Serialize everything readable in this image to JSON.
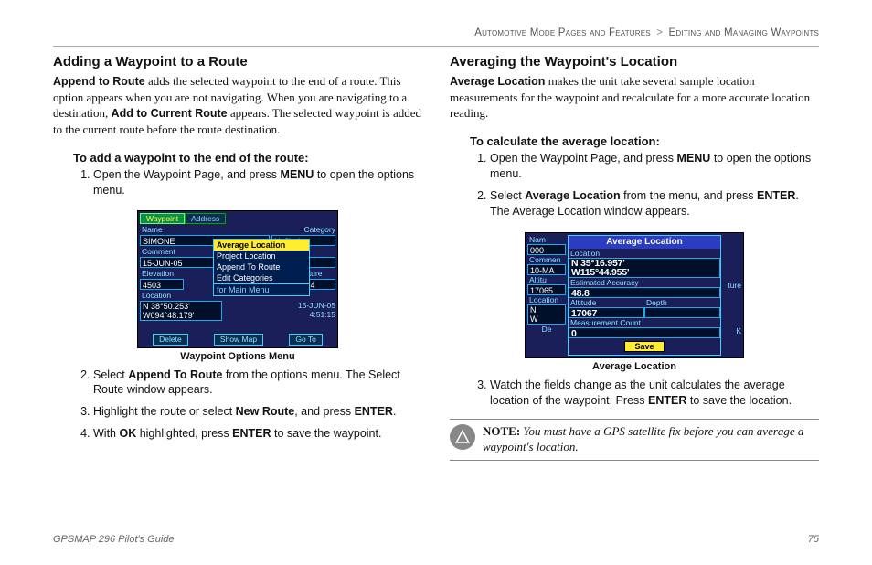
{
  "breadcrumb": {
    "a": "Automotive Mode Pages and Features",
    "b": "Editing and Managing Waypoints"
  },
  "left": {
    "h": "Adding a Waypoint to a Route",
    "intro_b1": "Append to Route",
    "intro_1": " adds the selected waypoint to the end of a route. This option appears when you are not navigating. When you are navigating to a destination, ",
    "intro_b2": "Add to Current Route",
    "intro_2": " appears. The selected waypoint is added to the current route before the route destination.",
    "proc_h": "To add a waypoint to the end of the route:",
    "s1_a": "Open the Waypoint Page, and press ",
    "s1_b": "MENU",
    "s1_c": " to open the options menu.",
    "cap": "Waypoint Options Menu",
    "s2_a": "Select ",
    "s2_b": "Append To Route",
    "s2_c": " from the options menu. The Select Route window appears.",
    "s3_a": "Highlight the route or select ",
    "s3_b": "New Route",
    "s3_c": ", and press ",
    "s3_d": "ENTER",
    "s3_e": ".",
    "s4_a": "With ",
    "s4_b": "OK",
    "s4_c": " highlighted, press ",
    "s4_d": "ENTER",
    "s4_e": " to save the waypoint."
  },
  "shot1": {
    "tab1": "Waypoint",
    "tab2": "Address",
    "lab_name": "Name",
    "lab_cat": "Category",
    "v_name": "SIMONE",
    "v_cat": "Unfiled",
    "lab_com": "Comment",
    "v_com": "15-JUN-05",
    "lab_elev": "Elevation",
    "v_elev": "4503",
    "lab_temp": "emperature",
    "v_temp": "1.4",
    "lab_loc": "Location",
    "loc1": "N 38°50.253'",
    "loc2": "W094°48.179'",
    "date": "15-JUN-05",
    "time": "4:51:15",
    "m0": "Average Location",
    "m1": "Project Location",
    "m2": "Append To Route",
    "m3": "Edit Categories",
    "m4": "for Main Menu",
    "b1": "Delete",
    "b2": "Show Map",
    "b3": "Go To"
  },
  "right": {
    "h": "Averaging the Waypoint's Location",
    "intro_b1": "Average Location",
    "intro_1": " makes the unit take several sample location measurements for the waypoint and recalculate for a more accurate location reading.",
    "proc_h": "To calculate the average location:",
    "s1_a": "Open the Waypoint Page, and press ",
    "s1_b": "MENU",
    "s1_c": " to open the options menu.",
    "s2_a": "Select ",
    "s2_b": "Average Location",
    "s2_c": " from the menu, and press ",
    "s2_d": "ENTER",
    "s2_e": ". The Average Location window appears.",
    "cap": "Average Location",
    "s3_a": "Watch the fields change as the unit calculates the average location of the waypoint. Press ",
    "s3_b": "ENTER",
    "s3_c": " to save the location."
  },
  "shot2": {
    "title": "Average Location",
    "side_name": "Nam",
    "side_v": "000",
    "side_com": "Commen",
    "side_date": "10-MA",
    "side_alt": "Altitu",
    "side_altv": "17065",
    "side_loc": "Location",
    "side_n": "N",
    "side_w": "W",
    "f_loc": "Location",
    "loc1": "N  35°16.957'",
    "loc2": "W115°44.955'",
    "f_ea": "Estimated Accuracy",
    "ea": "48.8",
    "f_alt": "Altitude",
    "alt": "17067",
    "f_dep": "Depth",
    "dep": "_____",
    "f_mc": "Measurement Count",
    "mc": "0",
    "side_ture": "ture",
    "save": "Save",
    "side_de": "De",
    "side_k": "K"
  },
  "note": {
    "lead": "NOTE:",
    "text": " You must have a GPS satellite fix before you can average a waypoint's location."
  },
  "footer": {
    "title": "GPSMAP 296 Pilot's Guide",
    "page": "75"
  }
}
